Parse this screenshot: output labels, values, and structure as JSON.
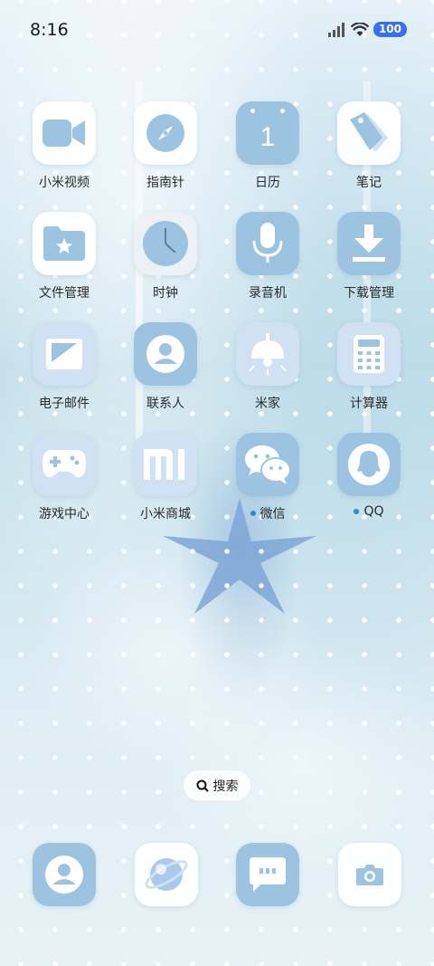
{
  "status_bar": {
    "time": "8:16",
    "battery": "100",
    "icons": [
      "signal-icon",
      "wifi-icon",
      "battery-icon"
    ]
  },
  "apps": [
    {
      "label": "小米视频",
      "icon": "video-camera-icon"
    },
    {
      "label": "指南针",
      "icon": "compass-icon"
    },
    {
      "label": "日历",
      "icon": "calendar-icon",
      "value": "1"
    },
    {
      "label": "笔记",
      "icon": "notes-tag-icon"
    },
    {
      "label": "文件管理",
      "icon": "folder-icon"
    },
    {
      "label": "时钟",
      "icon": "clock-icon"
    },
    {
      "label": "录音机",
      "icon": "microphone-icon"
    },
    {
      "label": "下载管理",
      "icon": "download-icon"
    },
    {
      "label": "电子邮件",
      "icon": "mail-icon"
    },
    {
      "label": "联系人",
      "icon": "contact-icon"
    },
    {
      "label": "米家",
      "icon": "lamp-icon"
    },
    {
      "label": "计算器",
      "icon": "calculator-icon"
    },
    {
      "label": "游戏中心",
      "icon": "gamepad-icon"
    },
    {
      "label": "小米商城",
      "icon": "mi-logo-icon"
    },
    {
      "label": "微信",
      "icon": "wechat-icon",
      "badge_dot": true
    },
    {
      "label": "QQ",
      "icon": "qq-penguin-icon",
      "badge_dot": true
    }
  ],
  "search": {
    "label": "搜索"
  },
  "dock": [
    {
      "icon": "phone-contact-icon"
    },
    {
      "icon": "browser-planet-icon"
    },
    {
      "icon": "messages-icon"
    },
    {
      "icon": "camera-icon"
    }
  ],
  "colors": {
    "accent": "#3b6ef0",
    "icon_blue": "#9cc4e0",
    "icon_light": "#cfe1f2",
    "badge_dot": "#3a87c8"
  }
}
